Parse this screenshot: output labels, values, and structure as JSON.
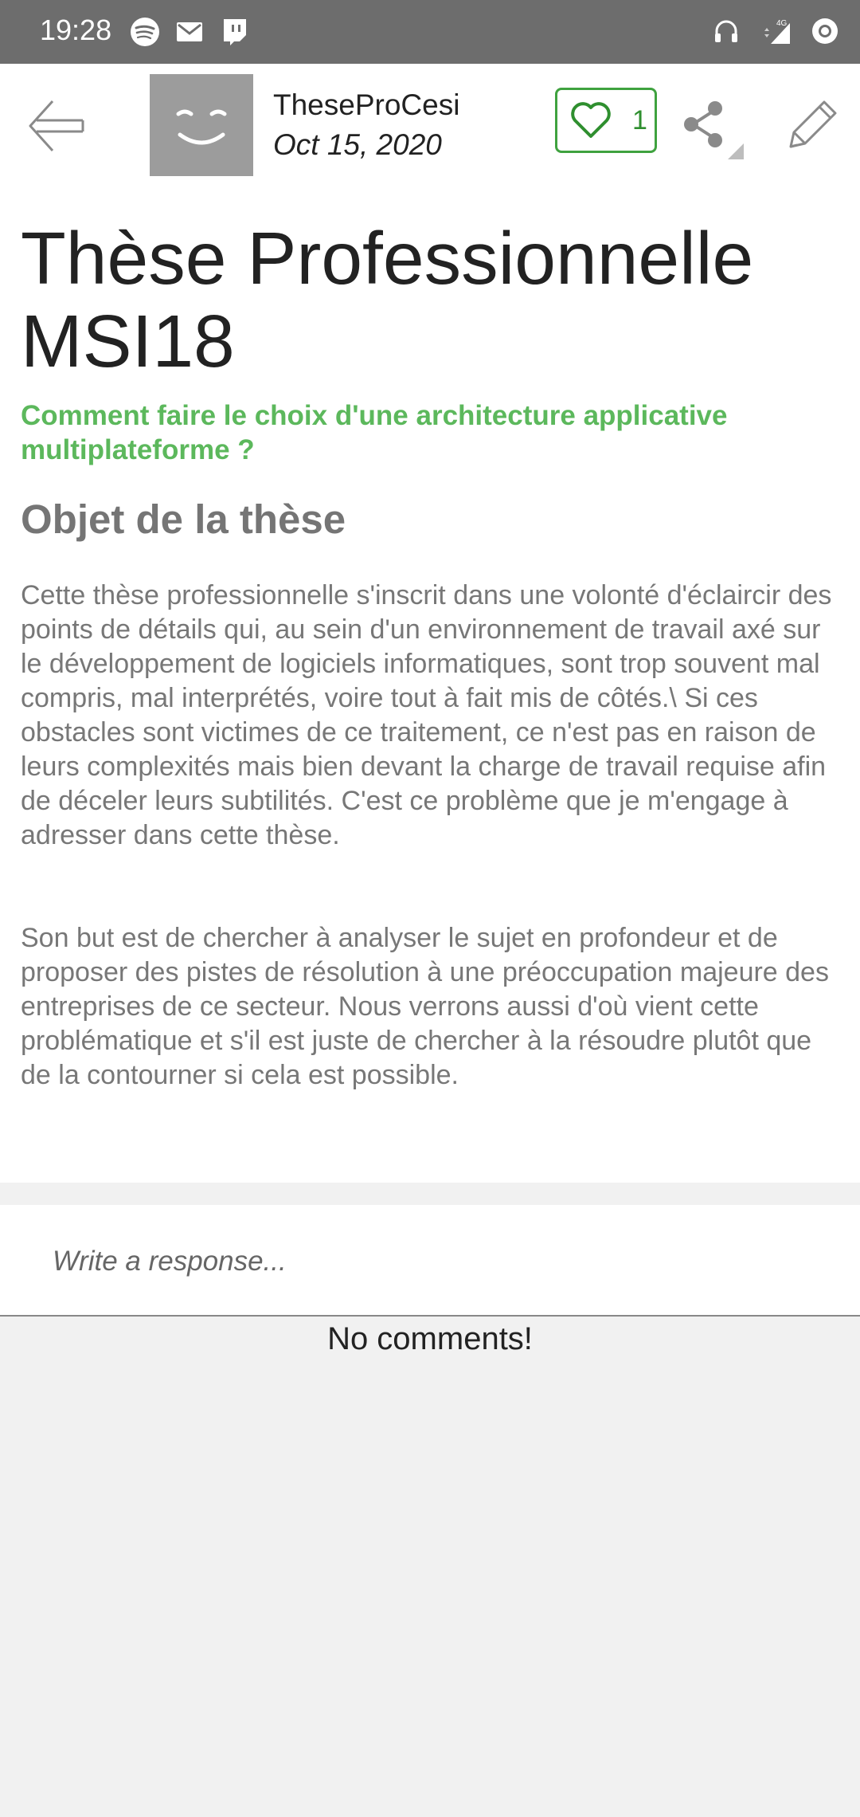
{
  "status_bar": {
    "time": "19:28",
    "left_icons": [
      "spotify-icon",
      "gmail-icon",
      "twitch-icon"
    ],
    "right_icons": [
      "headphones-icon",
      "signal-4g-icon",
      "sync-icon"
    ],
    "network_label": "4G"
  },
  "header": {
    "author": "TheseProCesi",
    "date": "Oct 15, 2020",
    "like_count": "1",
    "icons": [
      "back-arrow-icon",
      "avatar-smile-icon",
      "heart-icon",
      "share-icon",
      "pencil-icon"
    ]
  },
  "article": {
    "title": "Thèse Professionnelle MSI18",
    "subtitle": "Comment faire le choix d'une architecture applicative multiplateforme ?",
    "section_heading": "Objet de la thèse",
    "paragraphs": [
      "Cette thèse professionnelle s'inscrit dans une volonté d'éclaircir des points de détails qui, au sein d'un environnement de travail axé sur le développement de logiciels informatiques, sont trop souvent mal compris, mal interprétés, voire tout à fait mis de côtés.\\ Si ces obstacles sont victimes de ce traitement, ce n'est pas en raison de leurs complexités mais bien devant la charge de travail requise afin de déceler leurs subtilités. C'est ce problème que je m'engage à adresser dans cette thèse.",
      "Son but est de chercher à analyser le sujet en profondeur et de proposer des pistes de résolution à une préoccupation majeure des entreprises de ce secteur. Nous verrons aussi d'où vient cette problématique et s'il est juste de chercher à la résoudre plutôt que de la contourner si cela est possible."
    ]
  },
  "comments": {
    "placeholder": "Write a response...",
    "empty_message": "No comments!"
  },
  "colors": {
    "accent_green": "#5cb85c",
    "like_border": "#3fa23f",
    "status_bar": "#6d6d6d",
    "body_text": "#777777"
  }
}
